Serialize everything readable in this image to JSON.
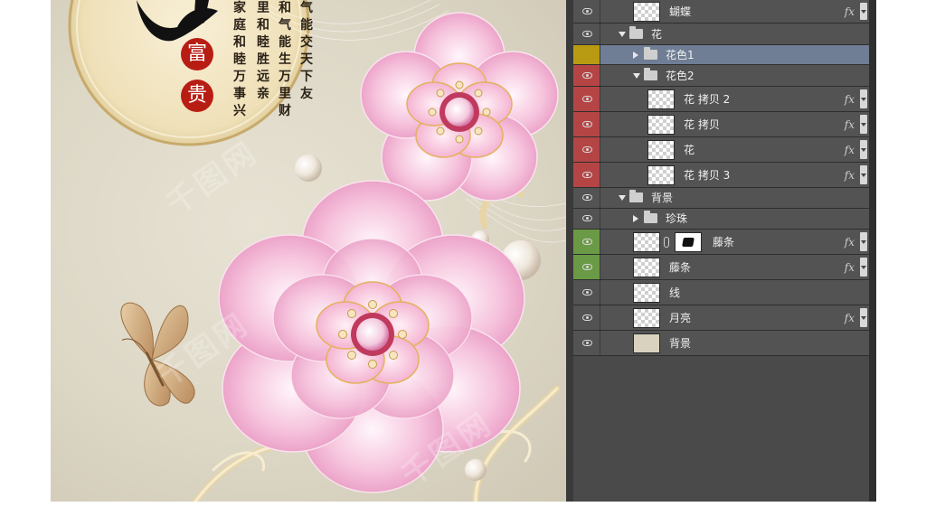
{
  "artwork": {
    "seal_chars": [
      "富",
      "贵"
    ],
    "poem_columns": [
      "气能交天下友",
      "和气能生万里财",
      "里和睦胜远亲",
      "家庭和睦万事兴"
    ],
    "watermark_text": "千图网"
  },
  "layers_panel": {
    "colors": {
      "panel_bg": "#535353",
      "selected_bg": "#6f7e94",
      "tag_yellow": "#b89b12",
      "tag_red": "#b54545",
      "tag_green": "#6a9a45",
      "none": "#535353"
    },
    "fx_label": "fx",
    "layers": [
      {
        "name": "蝴蝶",
        "kind": "layer",
        "indent": 2,
        "tag": "none",
        "fx": true,
        "thumb": "checker"
      },
      {
        "name": "花",
        "kind": "group",
        "indent": 1,
        "tag": "none",
        "expanded": true
      },
      {
        "name": "花色1",
        "kind": "group",
        "indent": 2,
        "tag": "yellow",
        "expanded": false,
        "selected": true,
        "visible": false
      },
      {
        "name": "花色2",
        "kind": "group",
        "indent": 2,
        "tag": "red",
        "expanded": true
      },
      {
        "name": "花 拷贝 2",
        "kind": "layer",
        "indent": 3,
        "tag": "red",
        "fx": true,
        "thumb": "checker"
      },
      {
        "name": "花 拷贝",
        "kind": "layer",
        "indent": 3,
        "tag": "red",
        "fx": true,
        "thumb": "checker"
      },
      {
        "name": "花",
        "kind": "layer",
        "indent": 3,
        "tag": "red",
        "fx": true,
        "thumb": "checker"
      },
      {
        "name": "花 拷贝 3",
        "kind": "layer",
        "indent": 3,
        "tag": "red",
        "fx": true,
        "thumb": "checker"
      },
      {
        "name": "背景",
        "kind": "group",
        "indent": 1,
        "tag": "none",
        "expanded": true
      },
      {
        "name": "珍珠",
        "kind": "group",
        "indent": 2,
        "tag": "none",
        "expanded": false
      },
      {
        "name": "藤条",
        "kind": "layer",
        "indent": 2,
        "tag": "green",
        "fx": true,
        "thumb": "checker",
        "mask": true
      },
      {
        "name": "藤条",
        "kind": "layer",
        "indent": 2,
        "tag": "green",
        "fx": true,
        "thumb": "checker"
      },
      {
        "name": "线",
        "kind": "layer",
        "indent": 2,
        "tag": "none",
        "fx": false,
        "thumb": "checker"
      },
      {
        "name": "月亮",
        "kind": "layer",
        "indent": 2,
        "tag": "none",
        "fx": true,
        "thumb": "checker"
      },
      {
        "name": "背景",
        "kind": "layer",
        "indent": 2,
        "tag": "none",
        "fx": false,
        "thumb": "plain"
      }
    ]
  }
}
